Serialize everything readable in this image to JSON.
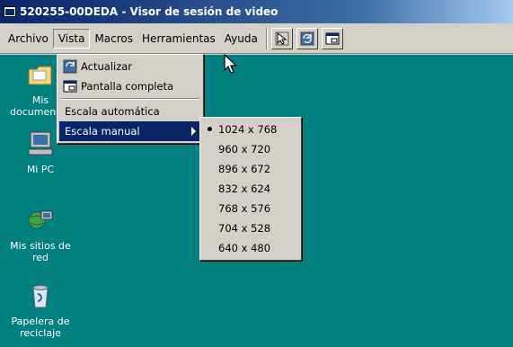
{
  "window": {
    "title": "520255-00DEDA - Visor de sesión de video"
  },
  "menubar": {
    "items": [
      {
        "label": "Archivo"
      },
      {
        "label": "Vista"
      },
      {
        "label": "Macros"
      },
      {
        "label": "Herramientas"
      },
      {
        "label": "Ayuda"
      }
    ]
  },
  "vista_menu": {
    "actualizar": "Actualizar",
    "pantalla_completa": "Pantalla completa",
    "escala_automatica": "Escala automática",
    "escala_manual": "Escala manual"
  },
  "escala_submenu": {
    "options": [
      "1024 x 768",
      "960 x 720",
      "896 x 672",
      "832 x 624",
      "768 x 576",
      "704 x 528",
      "640 x 480"
    ],
    "selected": "1024 x 768"
  },
  "desktop": {
    "icons": [
      {
        "label": "Mis documentos"
      },
      {
        "label": "Mi PC"
      },
      {
        "label": "Mis sitios de red"
      },
      {
        "label": "Papelera de reciclaje"
      }
    ]
  },
  "colors": {
    "desktop": "#008080",
    "highlight": "#0a246a",
    "face": "#d4d0c8"
  }
}
